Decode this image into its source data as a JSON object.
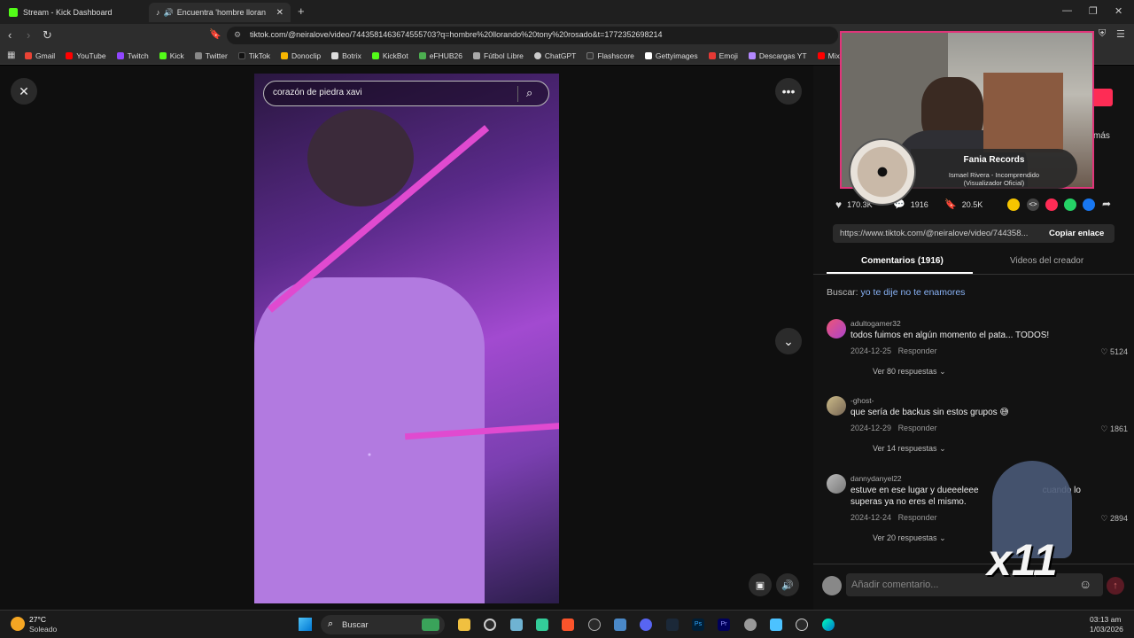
{
  "browser": {
    "tabs": [
      {
        "title": "Stream - Kick Dashboard",
        "active": false
      },
      {
        "title": "Encuentra 'hombre llorando t",
        "active": true
      }
    ],
    "new_tab": "+",
    "url": "tiktok.com/@neiralove/video/7443581463674555703?q=hombre%20llorando%20tony%20rosado&t=1772352698214",
    "bookmarks": [
      "Gmail",
      "YouTube",
      "Twitch",
      "Kick",
      "Twitter",
      "TikTok",
      "Donoclip",
      "Botrix",
      "KickBot",
      "eFHUB26",
      "Fútbol Libre",
      "ChatGPT",
      "Flashscore",
      "Gettyimages",
      "Emoji",
      "Descargas YT",
      "Mix M"
    ]
  },
  "video": {
    "search_value": "corazón de piedra xavi"
  },
  "overlay": {
    "music_title": "Fania Records",
    "music_subtitle_1": "Ismael Rivera - Incomprendido",
    "music_subtitle_2": "(Visualizador Oficial)",
    "combo_text": "x11"
  },
  "panel": {
    "partial_right": "más",
    "stats": {
      "likes": "170.3K",
      "comments": "1916",
      "saves": "20.5K"
    },
    "share_link": "https://www.tiktok.com/@neiralove/video/744358...",
    "copy_link": "Copiar enlace",
    "tab_comments": "Comentarios (1916)",
    "tab_creator": "Videos del creador",
    "search_label": "Buscar:",
    "search_query": "yo te dije no te enamores",
    "comments": [
      {
        "user": "adultogamer32",
        "text": "todos fuimos en algún momento el pata... TODOS!",
        "date": "2024-12-25",
        "reply": "Responder",
        "likes": "5124",
        "more": "Ver 80 respuestas"
      },
      {
        "user": "-ghost-",
        "text": "que sería de backus sin estos grupos 😅",
        "date": "2024-12-29",
        "reply": "Responder",
        "likes": "1861",
        "more": "Ver 14 respuestas"
      },
      {
        "user": "dannydanyel22",
        "text": "estuve en ese lugar y dueeeleee",
        "text_tail": "cuando lo",
        "text_line2": "superas ya no eres el mismo.",
        "date": "2024-12-24",
        "reply": "Responder",
        "likes": "2894",
        "more": "Ver 20 respuestas"
      }
    ],
    "comment_placeholder": "Añadir comentario..."
  },
  "taskbar": {
    "weather_temp": "27°C",
    "weather_desc": "Soleado",
    "search": "Buscar",
    "time": "03:13 am",
    "date": "1/03/2026"
  },
  "colors": {
    "accent_pink": "#fe2c55",
    "cam_border": "#e0357a",
    "link_blue": "#8ab4f8"
  }
}
